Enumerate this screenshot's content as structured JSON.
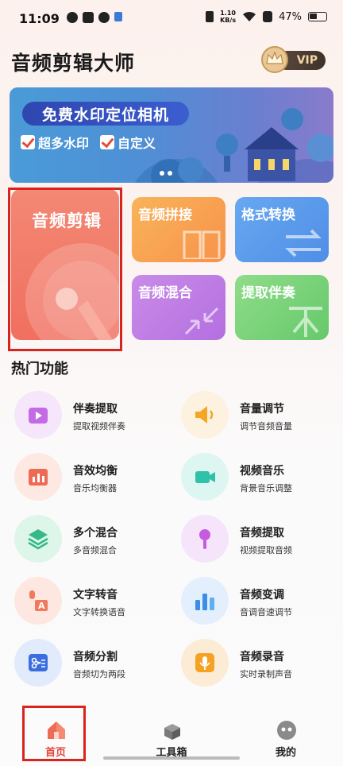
{
  "status_bar": {
    "time": "11:09",
    "net_speed_value": "1.10",
    "net_speed_unit": "KB/s",
    "battery": "47%"
  },
  "header": {
    "title": "音频剪辑大师",
    "vip_label": "VIP"
  },
  "banner": {
    "title": "免费水印定位相机",
    "features": [
      "超多水印",
      "自定义"
    ]
  },
  "tiles": {
    "audio_edit": "音频剪辑",
    "audio_concat": "音频拼接",
    "format_convert": "格式转换",
    "audio_mix": "音频混合",
    "extract_accompaniment": "提取伴奏"
  },
  "hot_section": {
    "title": "热门功能",
    "items": [
      {
        "name": "伴奏提取",
        "desc": "提取视频伴奏",
        "icon": "video-play-icon",
        "color": "#b86be0"
      },
      {
        "name": "音量调节",
        "desc": "调节音频音量",
        "icon": "speaker-icon",
        "color": "#f5a623"
      },
      {
        "name": "音效均衡",
        "desc": "音乐均衡器",
        "icon": "equalizer-icon",
        "color": "#ef6a54"
      },
      {
        "name": "视频音乐",
        "desc": "背景音乐调整",
        "icon": "video-camera-icon",
        "color": "#2fc2a8"
      },
      {
        "name": "多个混合",
        "desc": "多音频混合",
        "icon": "layers-icon",
        "color": "#33b98a"
      },
      {
        "name": "音频提取",
        "desc": "视频提取音频",
        "icon": "microphone-icon",
        "color": "#c65be0"
      },
      {
        "name": "文字转音",
        "desc": "文字转换语音",
        "icon": "text-to-speech-icon",
        "color": "#f07a5a"
      },
      {
        "name": "音频变调",
        "desc": "音调音速调节",
        "icon": "pitch-icon",
        "color": "#3b8ee8"
      },
      {
        "name": "音频分割",
        "desc": "音频切为两段",
        "icon": "scissors-icon",
        "color": "#3a6ee0"
      },
      {
        "name": "音频录音",
        "desc": "实时录制声音",
        "icon": "record-mic-icon",
        "color": "#f5a123"
      }
    ]
  },
  "bottom_nav": {
    "home": "首页",
    "toolbox": "工具箱",
    "mine": "我的"
  }
}
